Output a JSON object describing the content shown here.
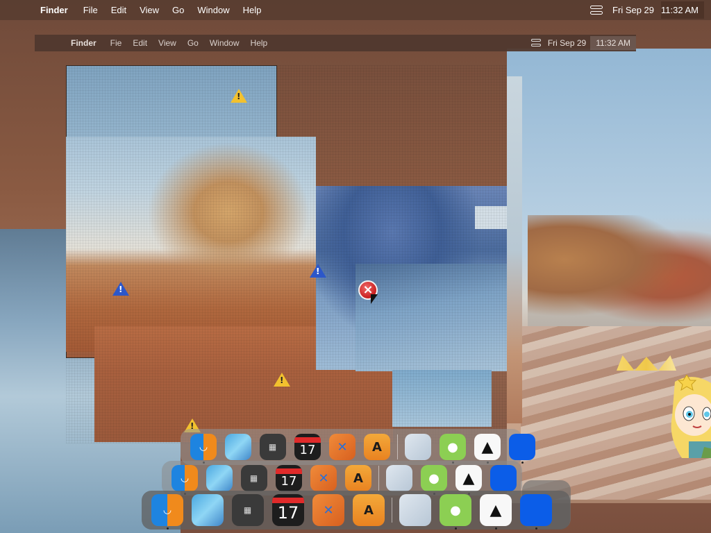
{
  "menubar": {
    "apple_icon": "",
    "app_name": "Finder",
    "menus": [
      "File",
      "Edit",
      "View",
      "Go",
      "Window",
      "Help"
    ],
    "date": "Fri Sep 29",
    "time": "11:32 AM"
  },
  "menubar_echo": {
    "apple_icon": "",
    "app_name": "Finder",
    "menus": [
      "Fie",
      "Edit",
      "View",
      "Go",
      "Window",
      "Help"
    ],
    "date": "Fri Sep 29",
    "time": "11:32 AM"
  },
  "alerts": {
    "warning_glyph": "!",
    "error_glyph": "×"
  },
  "dock_primary": {
    "calendar_day": "17",
    "calc_glyph": "▦",
    "finder_glyph": "◡",
    "xcode_glyph": "✕",
    "appstore_glyph": "A",
    "github_glyph": "●",
    "vercel_glyph": "▲"
  },
  "colors": {
    "accent_blue": "#0b5de8",
    "warning_yellow": "#f2c12e",
    "warning_blue": "#2c57c9",
    "error_red": "#c81e1e"
  }
}
